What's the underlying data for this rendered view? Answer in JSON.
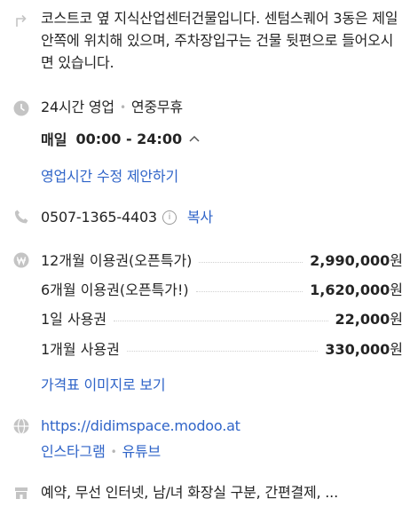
{
  "directions": {
    "text": "코스트코 옆 지식산업센터건물입니다. 센텀스퀘어 3동은 제일 안쪽에 위치해 있으며, 주차장입구는 건물 뒷편으로 들어오시면 있습니다."
  },
  "hours": {
    "status": "24시간 영업",
    "holiday": "연중무휴",
    "day_label": "매일",
    "time_range": "00:00 - 24:00",
    "suggest_edit_link": "영업시간 수정 제안하기"
  },
  "phone": {
    "number": "0507-1365-4403",
    "info_icon_symbol": "i",
    "copy_label": "복사"
  },
  "prices": {
    "items": [
      {
        "name": "12개월 이용권(오픈특가)",
        "amount": "2,990,000",
        "unit": "원"
      },
      {
        "name": "6개월 이용권(오픈특가!)",
        "amount": "1,620,000",
        "unit": "원"
      },
      {
        "name": "1일 사용권",
        "amount": "22,000",
        "unit": "원"
      },
      {
        "name": "1개월 사용권",
        "amount": "330,000",
        "unit": "원"
      }
    ],
    "view_image_link": "가격표 이미지로 보기"
  },
  "website": {
    "url": "https://didimspace.modoo.at",
    "links": [
      "인스타그램",
      "유튜브"
    ]
  },
  "amenities": {
    "text": "예약, 무선 인터넷, 남/녀 화장실 구분, 간편결제, ..."
  },
  "icons": {
    "directions": "directions-turn-icon",
    "hours": "clock-icon",
    "phone": "phone-icon",
    "price": "won-coin-icon",
    "website": "globe-icon",
    "amenities": "store-icon",
    "chevron": "chevron-up-icon"
  },
  "colors": {
    "link": "#2f64c8",
    "icon": "#c4c4c4",
    "text": "#242424"
  }
}
